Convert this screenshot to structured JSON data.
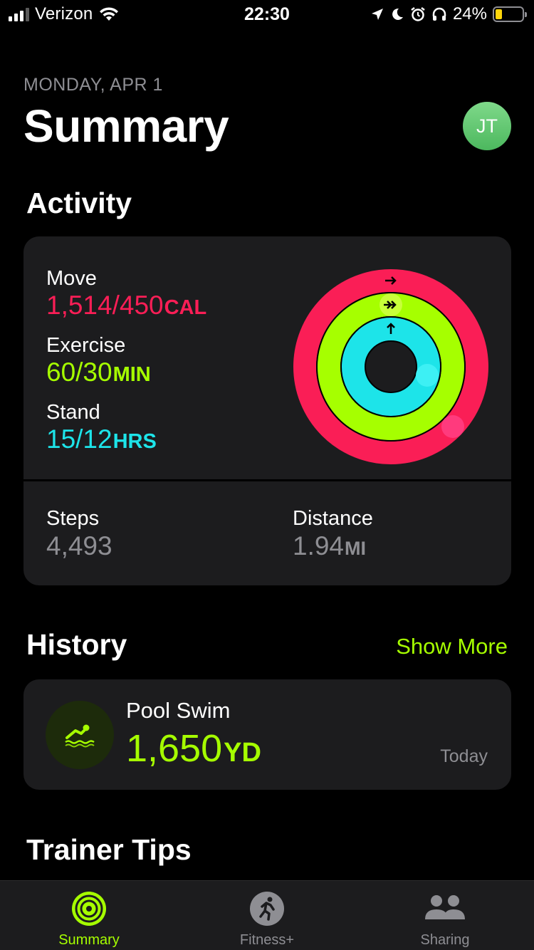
{
  "status_bar": {
    "carrier": "Verizon",
    "time": "22:30",
    "battery_pct": "24%",
    "battery_level": 0.24,
    "icons": [
      "signal-icon",
      "wifi-icon",
      "location-arrow-icon",
      "moon-icon",
      "alarm-icon",
      "headphones-icon",
      "battery-icon"
    ]
  },
  "header": {
    "date": "MONDAY, APR 1",
    "title": "Summary",
    "avatar_initials": "JT"
  },
  "activity": {
    "section_title": "Activity",
    "move": {
      "label": "Move",
      "value": "1,514/450",
      "unit": "CAL",
      "progress": 3.36,
      "color": "#fa1e56"
    },
    "exercise": {
      "label": "Exercise",
      "value": "60/30",
      "unit": "MIN",
      "progress": 2.0,
      "color": "#a6ff00"
    },
    "stand": {
      "label": "Stand",
      "value": "15/12",
      "unit": "HRS",
      "progress": 1.25,
      "color": "#1de4e9"
    },
    "steps": {
      "label": "Steps",
      "value": "4,493"
    },
    "distance": {
      "label": "Distance",
      "value": "1.94",
      "unit": "MI"
    }
  },
  "history": {
    "section_title": "History",
    "show_more": "Show More",
    "workout": {
      "icon": "pool-swim-icon",
      "name": "Pool Swim",
      "value": "1,650",
      "unit": "YD",
      "date": "Today"
    }
  },
  "trainer_tips": {
    "section_title": "Trainer Tips"
  },
  "tab_bar": {
    "tabs": [
      {
        "label": "Summary",
        "icon": "activity-rings-icon",
        "active": true
      },
      {
        "label": "Fitness+",
        "icon": "runner-icon",
        "active": false
      },
      {
        "label": "Sharing",
        "icon": "people-icon",
        "active": false
      }
    ]
  },
  "colors": {
    "accent": "#a6ff00",
    "move": "#fa1e56",
    "exercise": "#a6ff00",
    "stand": "#1de4e9",
    "card": "#1c1c1e"
  }
}
